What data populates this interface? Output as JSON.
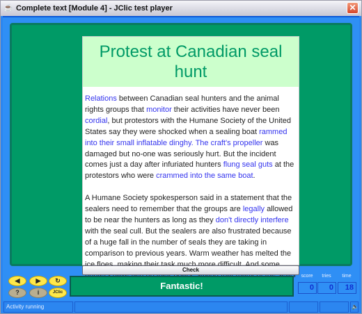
{
  "window": {
    "title": "Complete text [Module 4] - JClic test player"
  },
  "main": {
    "title": "Protest at Canadian seal hunt",
    "paragraphs": [
      {
        "segments": [
          {
            "text": "Relations",
            "hl": true
          },
          {
            "text": " between Canadian seal hunters and the animal rights groups that ",
            "hl": false
          },
          {
            "text": "monitor",
            "hl": true
          },
          {
            "text": " their activities have never been ",
            "hl": false
          },
          {
            "text": "cordial",
            "hl": true
          },
          {
            "text": ", but protestors with the Humane Society of the United States say they were shocked when a sealing boat ",
            "hl": false
          },
          {
            "text": "rammed into their small inflatable dinghy. The craft's propeller",
            "hl": true
          },
          {
            "text": " was damaged but no-one was seriously hurt. But the incident comes just a day after infuriated hunters ",
            "hl": false
          },
          {
            "text": "flung seal guts",
            "hl": true
          },
          {
            "text": " at the protestors who were ",
            "hl": false
          },
          {
            "text": "crammed into the same boat",
            "hl": true
          },
          {
            "text": ".",
            "hl": false
          }
        ]
      },
      {
        "segments": [
          {
            "text": "A Humane Society spokesperson said in a statement that the sealers need to remember that the groups are ",
            "hl": false
          },
          {
            "text": "legally",
            "hl": true
          },
          {
            "text": " allowed to be near the hunters as long as they ",
            "hl": false
          },
          {
            "text": "don't directly interfere",
            "hl": true
          },
          {
            "text": " with the seal cull. But the sealers are also frustrated because of a huge fall in the number of seals they are taking in comparison to previous years. Warm weather has melted the ice floes, making their task much more difficult. And some hunters have tied up their boats, saying that many of the seals are too young to be legally killed.",
            "hl": false
          }
        ]
      }
    ],
    "check_label": "Check"
  },
  "controls": {
    "help": "?",
    "info": "i",
    "jclic": "JClic",
    "message": "Fantastic!"
  },
  "counters": {
    "score_label": "score",
    "tries_label": "tries",
    "time_label": "time",
    "score": "0",
    "tries": "0",
    "time": "18"
  },
  "status": {
    "text": "Activity running"
  },
  "colors": {
    "highlight": "#3333ee",
    "green": "#009a66",
    "header_bg": "#ccffcc"
  }
}
